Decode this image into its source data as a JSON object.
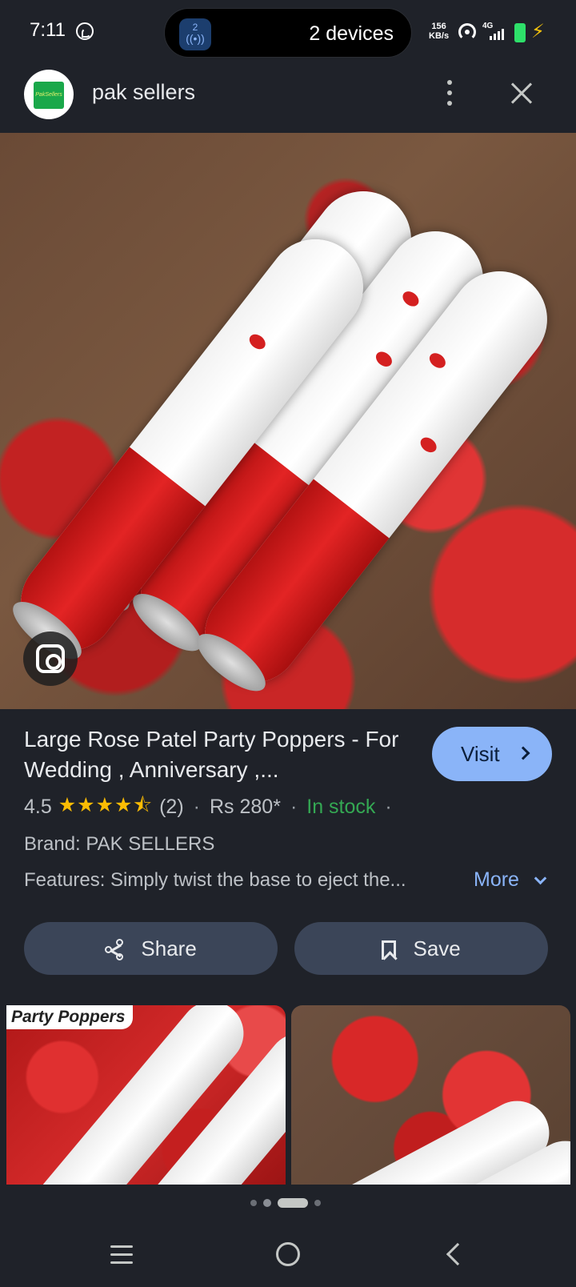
{
  "status_bar": {
    "time": "7:11",
    "pill_badge": "2",
    "pill_text": "2 devices",
    "net_speed_value": "156",
    "net_speed_unit": "KB/s",
    "network_type": "4G",
    "icons": [
      "whatsapp-icon",
      "nearby-share-icon",
      "hotspot-icon",
      "signal-icon",
      "battery-icon",
      "charging-bolt-icon"
    ]
  },
  "header": {
    "site_name": "pak sellers",
    "logo_text": "PakSellers"
  },
  "product": {
    "title": "Large Rose Patel Party Poppers - For Wedding , Anniversary ,...",
    "visit_label": "Visit",
    "rating": "4.5",
    "stars": "★★★★⯪",
    "review_count": "(2)",
    "price": "Rs 280*",
    "stock": "In stock",
    "brand": "Brand: PAK SELLERS",
    "features": "Features: Simply twist the base to eject the...",
    "more_label": "More"
  },
  "actions": {
    "share_label": "Share",
    "save_label": "Save"
  },
  "related": {
    "thumb_1_label": "Party Poppers"
  },
  "pager": {
    "total": 4,
    "active_index": 2
  },
  "colors": {
    "background": "#1f2229",
    "accent": "#8ab4f8",
    "in_stock": "#34a853",
    "star": "#fbbc04",
    "button": "#3b4558"
  }
}
